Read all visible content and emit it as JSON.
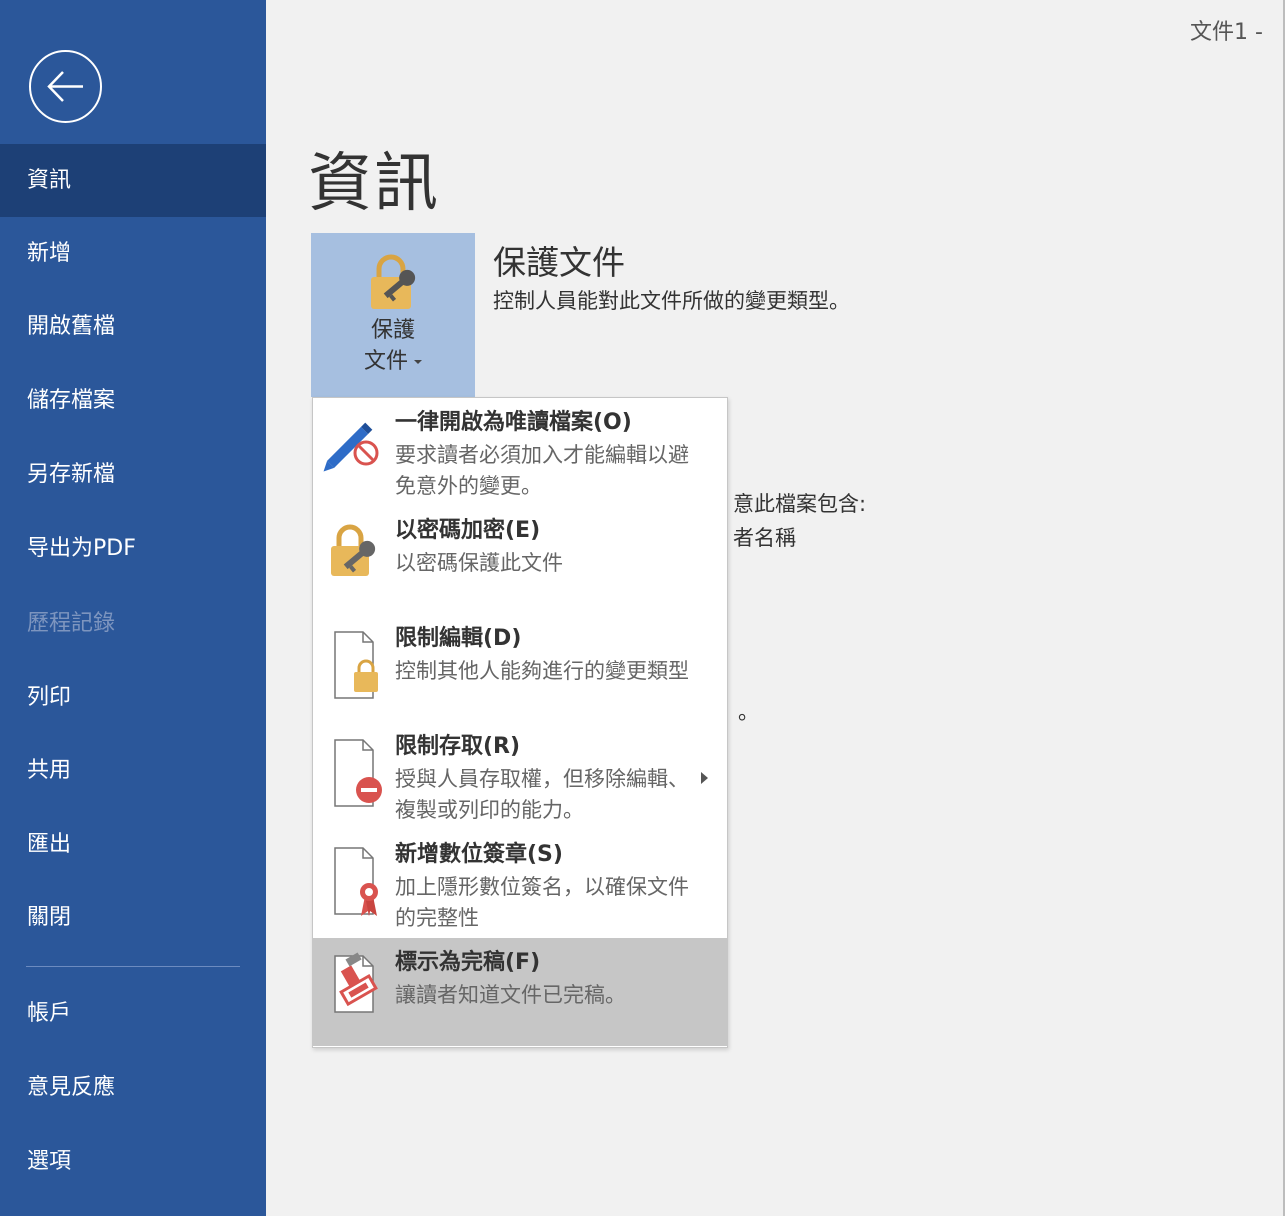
{
  "window": {
    "doc_title": "文件1 -"
  },
  "sidebar": {
    "back_label": "back-arrow",
    "items": [
      {
        "label": "資訊",
        "state": "active"
      },
      {
        "label": "新增",
        "state": "normal"
      },
      {
        "label": "開啟舊檔",
        "state": "normal"
      },
      {
        "label": "儲存檔案",
        "state": "normal"
      },
      {
        "label": "另存新檔",
        "state": "normal"
      },
      {
        "label": "导出为PDF",
        "state": "normal"
      },
      {
        "label": "歷程記錄",
        "state": "disabled"
      },
      {
        "label": "列印",
        "state": "normal"
      },
      {
        "label": "共用",
        "state": "normal"
      },
      {
        "label": "匯出",
        "state": "normal"
      },
      {
        "label": "關閉",
        "state": "normal"
      }
    ],
    "bottom_items": [
      {
        "label": "帳戶"
      },
      {
        "label": "意見反應"
      },
      {
        "label": "選項"
      }
    ]
  },
  "main": {
    "page_title": "資訊",
    "protect_button": {
      "line1": "保護",
      "line2": "文件",
      "icon": "lock-key-icon"
    },
    "protect_section": {
      "title": "保護文件",
      "description": "控制人員能對此文件所做的變更類型。"
    },
    "partially_hidden": {
      "line1": "意此檔案包含:",
      "line2": "者名稱",
      "line3": "。"
    }
  },
  "protect_menu": {
    "items": [
      {
        "title": "一律開啟為唯讀檔案(O)",
        "description": "要求讀者必須加入才能編輯以避免意外的變更。",
        "icon": "pencil-no-icon"
      },
      {
        "title": "以密碼加密(E)",
        "description": "以密碼保護此文件",
        "icon": "lock-key-icon"
      },
      {
        "title": "限制編輯(D)",
        "description": "控制其他人能夠進行的變更類型",
        "icon": "document-lock-icon"
      },
      {
        "title": "限制存取(R)",
        "description": "授與人員存取權，但移除編輯、複製或列印的能力。",
        "icon": "document-restrict-icon",
        "has_submenu": true
      },
      {
        "title": "新增數位簽章(S)",
        "description": "加上隱形數位簽名，以確保文件的完整性",
        "icon": "document-ribbon-icon"
      },
      {
        "title": "標示為完稿(F)",
        "description": "讓讀者知道文件已完稿。",
        "icon": "document-stamp-icon",
        "highlighted": true
      }
    ]
  },
  "colors": {
    "sidebar": "#2b579a",
    "sidebar_active": "#1d4076",
    "protect_button": "#a6bfe0",
    "menu_highlight": "#c6c6c6",
    "lock_gold": "#e8b85a",
    "icon_red": "#d9534f"
  }
}
